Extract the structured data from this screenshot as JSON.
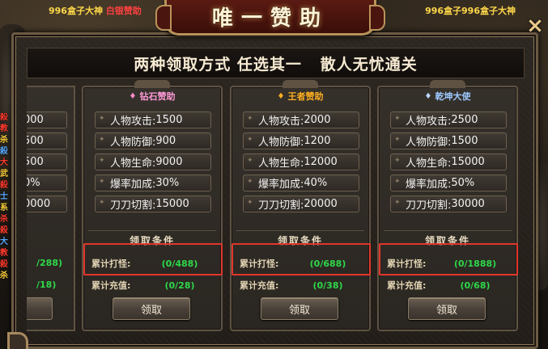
{
  "window": {
    "title": "唯一赞助",
    "subtitle": "两种领取方式 任选其一   散人无忧通关",
    "close_icon": "×"
  },
  "background": {
    "top_left_text": "996盒子大神",
    "top_left_text_2": "白银赞助",
    "top_right_text": "996盒子996盒子大神",
    "side_labels": [
      "殺",
      "教",
      "杀",
      "殺",
      "大",
      "武",
      "殺",
      "士",
      "系",
      "杀",
      "殺",
      "大",
      "教",
      "殺",
      "杀"
    ]
  },
  "partial_card": {
    "stat_values": [
      "000",
      "500",
      "500",
      "0%",
      "0000"
    ],
    "cond_values": [
      "/288)",
      "/18)"
    ]
  },
  "cards": [
    {
      "name": "钻石赞助",
      "gem_icon": "♦",
      "name_color": "#ff9ad8",
      "gem_color": "#ff8acb",
      "stats": [
        {
          "label": "人物攻击:",
          "value": "1500"
        },
        {
          "label": "人物防御:",
          "value": "900"
        },
        {
          "label": "人物生命:",
          "value": "9000"
        },
        {
          "label": "爆率加成:",
          "value": "30%"
        },
        {
          "label": "刀刀切割:",
          "value": "15000"
        }
      ],
      "conditions_title": "领取条件",
      "conditions": [
        {
          "label": "累计打怪:",
          "value": "(0/488)"
        },
        {
          "label": "累计充值:",
          "value": "(0/28)"
        }
      ],
      "claim_label": "领取"
    },
    {
      "name": "王者赞助",
      "gem_icon": "♦",
      "name_color": "#ffb020",
      "gem_color": "#ffb020",
      "stats": [
        {
          "label": "人物攻击:",
          "value": "2000"
        },
        {
          "label": "人物防御:",
          "value": "1200"
        },
        {
          "label": "人物生命:",
          "value": "12000"
        },
        {
          "label": "爆率加成:",
          "value": "40%"
        },
        {
          "label": "刀刀切割:",
          "value": "20000"
        }
      ],
      "conditions_title": "领取条件",
      "conditions": [
        {
          "label": "累计打怪:",
          "value": "(0/688)"
        },
        {
          "label": "累计充值:",
          "value": "(0/38)"
        }
      ],
      "claim_label": "领取"
    },
    {
      "name": "乾坤大使",
      "gem_icon": "♦",
      "name_color": "#9ec8ff",
      "gem_color": "#bcd8ff",
      "stats": [
        {
          "label": "人物攻击:",
          "value": "2500"
        },
        {
          "label": "人物防御:",
          "value": "1500"
        },
        {
          "label": "人物生命:",
          "value": "15000"
        },
        {
          "label": "爆率加成:",
          "value": "50%"
        },
        {
          "label": "刀刀切割:",
          "value": "30000"
        }
      ],
      "conditions_title": "领取条件",
      "conditions": [
        {
          "label": "累计打怪:",
          "value": "(0/1888)"
        },
        {
          "label": "累计充值:",
          "value": "(0/68)"
        }
      ],
      "claim_label": "领取"
    }
  ],
  "colors": {
    "highlight": "#e2362b",
    "condition_value": "#2ed84a"
  }
}
